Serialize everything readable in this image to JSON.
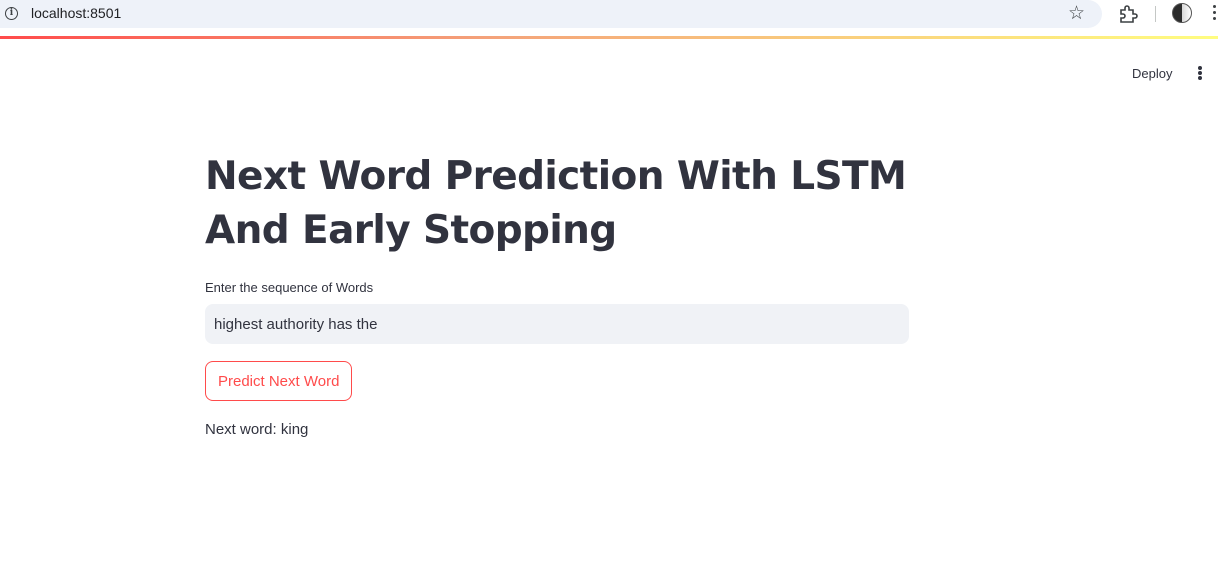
{
  "browser": {
    "url": "localhost:8501",
    "icons": [
      "info-icon",
      "star-icon",
      "extensions-icon",
      "profile-icon",
      "browser-menu-icon"
    ]
  },
  "header": {
    "deploy_label": "Deploy",
    "menu_icon": "vertical-dots-icon"
  },
  "main": {
    "title": "Next Word Prediction With LSTM And Early Stopping",
    "input_label": "Enter the sequence of Words",
    "input_value": "highest authority has the",
    "button_label": "Predict Next Word",
    "result": "Next word: king"
  },
  "colors": {
    "accent": "#ff4b4b",
    "text": "#31333f",
    "input_bg": "#f0f2f6",
    "url_bar_bg": "#eef2f9"
  }
}
